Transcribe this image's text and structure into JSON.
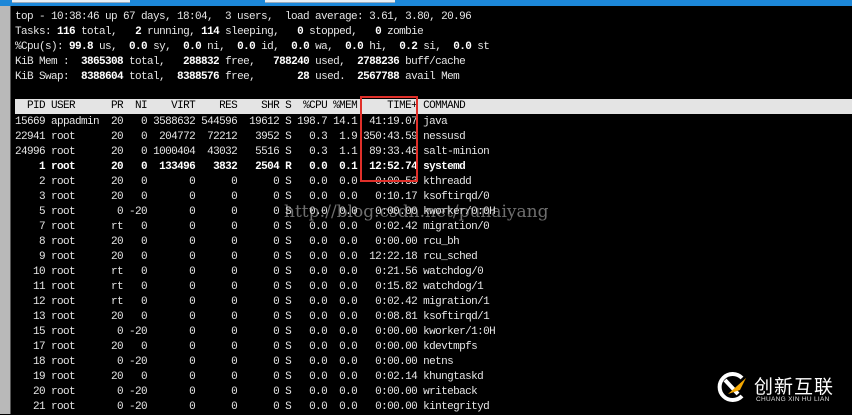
{
  "summary": {
    "line1": "top - 10:38:46 up 67 days, 18:04,  3 users,  load average: 3.61, 3.80, 20.96",
    "tasks": {
      "label": "Tasks:",
      "total": "116",
      "total_l": " total,   ",
      "running": "2",
      "running_l": " running, ",
      "sleeping": "114",
      "sleeping_l": " sleeping,   ",
      "stopped": "0",
      "stopped_l": " stopped,   ",
      "zombie": "0",
      "zombie_l": " zombie"
    },
    "cpu": {
      "label": "%Cpu(s): ",
      "us": "99.8",
      "us_l": " us,  ",
      "sy": "0.0",
      "sy_l": " sy,  ",
      "ni": "0.0",
      "ni_l": " ni,  ",
      "id": "0.0",
      "id_l": " id,  ",
      "wa": "0.0",
      "wa_l": " wa,  ",
      "hi": "0.0",
      "hi_l": " hi,  ",
      "si": "0.2",
      "si_l": " si,  ",
      "st": "0.0",
      "st_l": " st"
    },
    "mem": {
      "label": "KiB Mem :  ",
      "total": "3865308",
      "total_l": " total,   ",
      "free": "288832",
      "free_l": " free,   ",
      "used": "788240",
      "used_l": " used,  ",
      "buff": "2788236",
      "buff_l": " buff/cache"
    },
    "swap": {
      "label": "KiB Swap:  ",
      "total": "8388604",
      "total_l": " total,  ",
      "free": "8388576",
      "free_l": " free,       ",
      "used": "28",
      "used_l": " used.  ",
      "avail": "2567788",
      "avail_l": " avail Mem"
    }
  },
  "table": {
    "columns": [
      "PID",
      "USER",
      "PR",
      "NI",
      "VIRT",
      "RES",
      "SHR",
      "S",
      "%CPU",
      "%MEM",
      "TIME+",
      "COMMAND"
    ],
    "rows": [
      [
        "15669",
        "appadmin",
        "20",
        "0",
        "3588632",
        "544596",
        "19612",
        "S",
        "198.7",
        "14.1",
        "41:19.07",
        "java"
      ],
      [
        "22941",
        "root",
        "20",
        "0",
        "204772",
        "72212",
        "3952",
        "S",
        "0.3",
        "1.9",
        "350:43.59",
        "nessusd"
      ],
      [
        "24996",
        "root",
        "20",
        "0",
        "1000404",
        "43032",
        "5516",
        "S",
        "0.3",
        "1.1",
        "89:33.46",
        "salt-minion"
      ],
      [
        "1",
        "root",
        "20",
        "0",
        "133496",
        "3832",
        "2504",
        "R",
        "0.0",
        "0.1",
        "12:52.74",
        "systemd"
      ],
      [
        "2",
        "root",
        "20",
        "0",
        "0",
        "0",
        "0",
        "S",
        "0.0",
        "0.0",
        "0:00.53",
        "kthreadd"
      ],
      [
        "3",
        "root",
        "20",
        "0",
        "0",
        "0",
        "0",
        "S",
        "0.0",
        "0.0",
        "0:10.17",
        "ksoftirqd/0"
      ],
      [
        "5",
        "root",
        "0",
        "-20",
        "0",
        "0",
        "0",
        "S",
        "0.0",
        "0.0",
        "0:00.00",
        "kworker/0:0H"
      ],
      [
        "7",
        "root",
        "rt",
        "0",
        "0",
        "0",
        "0",
        "S",
        "0.0",
        "0.0",
        "0:02.42",
        "migration/0"
      ],
      [
        "8",
        "root",
        "20",
        "0",
        "0",
        "0",
        "0",
        "S",
        "0.0",
        "0.0",
        "0:00.00",
        "rcu_bh"
      ],
      [
        "9",
        "root",
        "20",
        "0",
        "0",
        "0",
        "0",
        "S",
        "0.0",
        "0.0",
        "12:22.18",
        "rcu_sched"
      ],
      [
        "10",
        "root",
        "rt",
        "0",
        "0",
        "0",
        "0",
        "S",
        "0.0",
        "0.0",
        "0:21.56",
        "watchdog/0"
      ],
      [
        "11",
        "root",
        "rt",
        "0",
        "0",
        "0",
        "0",
        "S",
        "0.0",
        "0.0",
        "0:15.82",
        "watchdog/1"
      ],
      [
        "12",
        "root",
        "rt",
        "0",
        "0",
        "0",
        "0",
        "S",
        "0.0",
        "0.0",
        "0:02.42",
        "migration/1"
      ],
      [
        "13",
        "root",
        "20",
        "0",
        "0",
        "0",
        "0",
        "S",
        "0.0",
        "0.0",
        "0:08.81",
        "ksoftirqd/1"
      ],
      [
        "15",
        "root",
        "0",
        "-20",
        "0",
        "0",
        "0",
        "S",
        "0.0",
        "0.0",
        "0:00.00",
        "kworker/1:0H"
      ],
      [
        "17",
        "root",
        "20",
        "0",
        "0",
        "0",
        "0",
        "S",
        "0.0",
        "0.0",
        "0:00.00",
        "kdevtmpfs"
      ],
      [
        "18",
        "root",
        "0",
        "-20",
        "0",
        "0",
        "0",
        "S",
        "0.0",
        "0.0",
        "0:00.00",
        "netns"
      ],
      [
        "19",
        "root",
        "20",
        "0",
        "0",
        "0",
        "0",
        "S",
        "0.0",
        "0.0",
        "0:02.14",
        "khungtaskd"
      ],
      [
        "20",
        "root",
        "0",
        "-20",
        "0",
        "0",
        "0",
        "S",
        "0.0",
        "0.0",
        "0:00.00",
        "writeback"
      ],
      [
        "21",
        "root",
        "0",
        "-20",
        "0",
        "0",
        "0",
        "S",
        "0.0",
        "0.0",
        "0:00.00",
        "kintegrityd"
      ]
    ],
    "bold_row_pid": "1"
  },
  "watermark": "http://blog.csdn.net/punaiyang",
  "logo": {
    "cn": "创新互联",
    "en": "CHUANG XIN HU LIAN"
  },
  "colors": {
    "highlight_box": "#e0302a",
    "header_bg": "#e4e4e4",
    "titlebar": "#1c87d8",
    "logo_accent": "#f5a800"
  }
}
